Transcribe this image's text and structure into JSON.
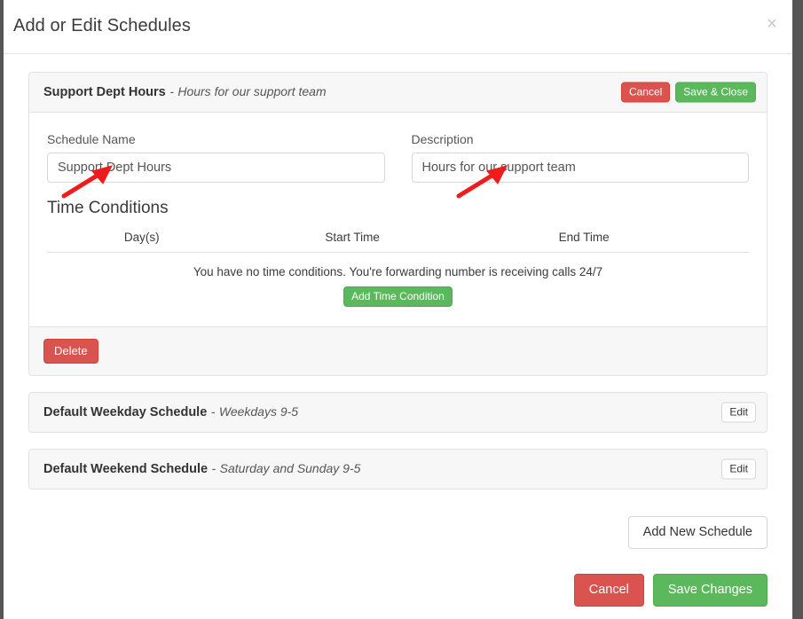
{
  "modal": {
    "title": "Add or Edit Schedules",
    "close_icon": "close-icon",
    "close_label": "×"
  },
  "active_schedule": {
    "title": "Support Dept Hours",
    "separator": "-",
    "description": "Hours for our support team",
    "cancel_label": "Cancel",
    "save_close_label": "Save & Close",
    "delete_label": "Delete",
    "form": {
      "name_label": "Schedule Name",
      "name_value": "Support Dept Hours",
      "name_placeholder": "Schedule Name",
      "description_label": "Description",
      "description_value": "Hours for our support team",
      "description_placeholder": "Description"
    },
    "time_conditions": {
      "section_title": "Time Conditions",
      "columns": [
        "Day(s)",
        "Start Time",
        "End Time"
      ],
      "rows": [],
      "empty_message": "You have no time conditions. You're forwarding number is receiving calls 24/7",
      "add_button_label": "Add Time Condition"
    }
  },
  "other_schedules": [
    {
      "title": "Default Weekday Schedule",
      "separator": "-",
      "description": "Weekdays 9-5",
      "edit_label": "Edit"
    },
    {
      "title": "Default Weekend Schedule",
      "separator": "-",
      "description": "Saturday and Sunday 9-5",
      "edit_label": "Edit"
    }
  ],
  "footer": {
    "add_new_schedule_label": "Add New Schedule",
    "cancel_label": "Cancel",
    "save_changes_label": "Save Changes"
  },
  "annotations": [
    {
      "name": "arrow-to-schedule-name-input",
      "color": "#ee1c1c"
    },
    {
      "name": "arrow-to-description-input",
      "color": "#ee1c1c"
    }
  ],
  "colors": {
    "danger": "#d9534f",
    "success": "#5cb85c",
    "annotation": "#ee1c1c",
    "page_background": "#555553"
  }
}
